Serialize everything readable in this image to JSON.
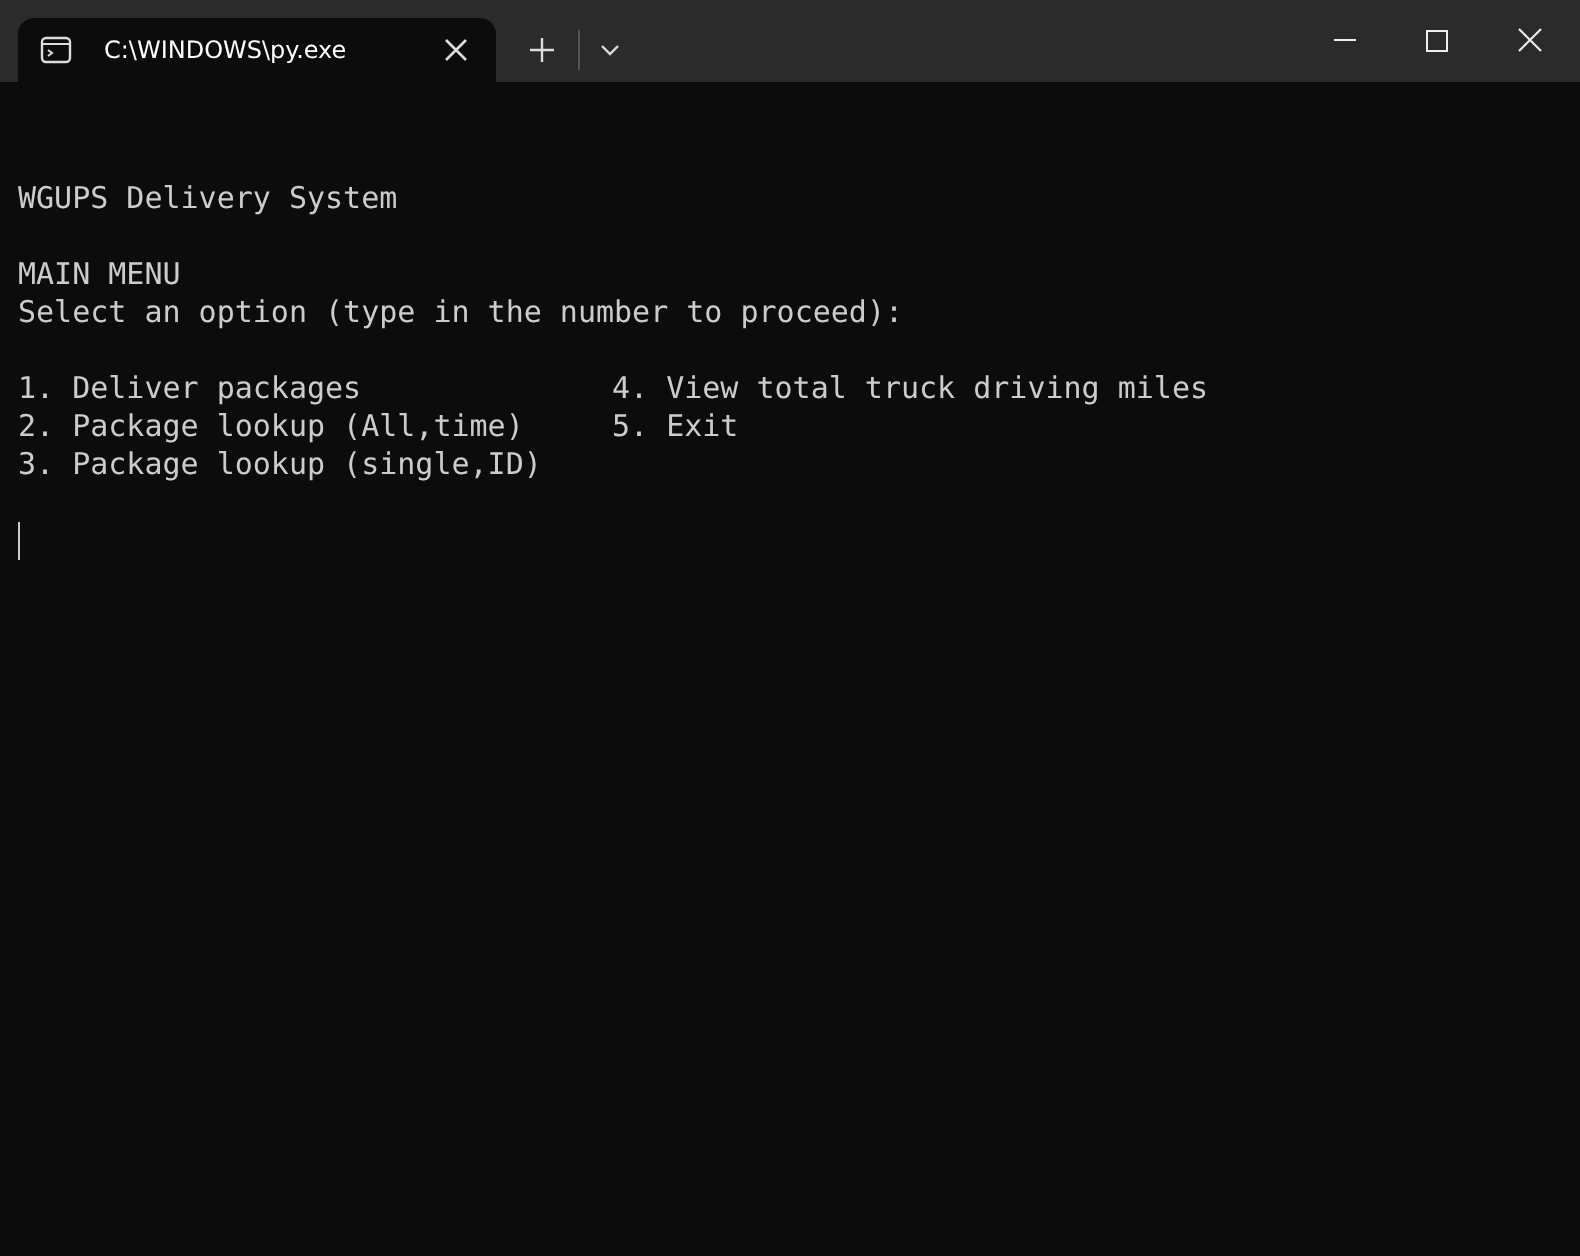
{
  "tab": {
    "title": "C:\\WINDOWS\\py.exe",
    "selected": true
  },
  "terminal": {
    "heading": "WGUPS Delivery System",
    "menu_title": "MAIN MENU",
    "prompt": "Select an option (type in the number to proceed):",
    "options": [
      {
        "left": "1. Deliver packages",
        "right": "4. View total truck driving miles"
      },
      {
        "left": "2. Package lookup (All,time)",
        "right": "5. Exit"
      },
      {
        "left": "3. Package lookup (single,ID)"
      }
    ]
  }
}
